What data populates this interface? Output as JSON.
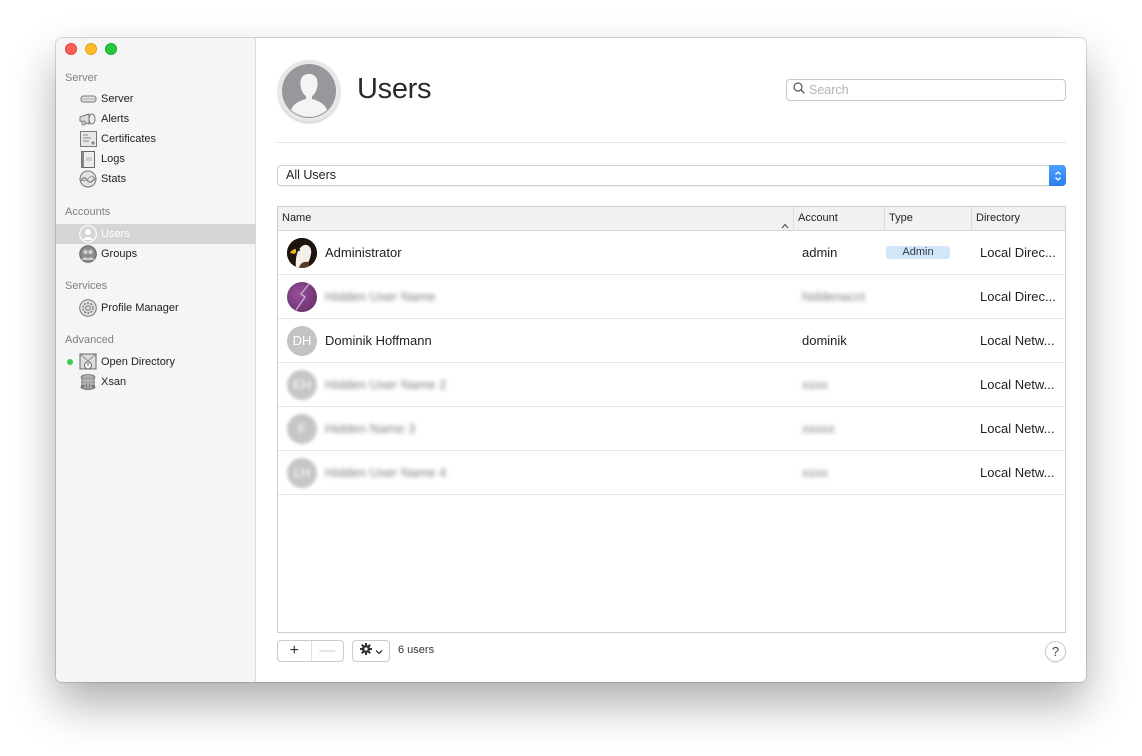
{
  "window": {
    "traffic_lights": [
      "close",
      "minimize",
      "zoom"
    ]
  },
  "sidebar": {
    "sections": [
      {
        "title": "Server",
        "items": [
          {
            "label": "Server",
            "icon": "server-icon"
          },
          {
            "label": "Alerts",
            "icon": "megaphone-icon"
          },
          {
            "label": "Certificates",
            "icon": "certificate-icon"
          },
          {
            "label": "Logs",
            "icon": "log-book-icon"
          },
          {
            "label": "Stats",
            "icon": "stats-icon"
          }
        ]
      },
      {
        "title": "Accounts",
        "items": [
          {
            "label": "Users",
            "icon": "user-icon",
            "selected": true
          },
          {
            "label": "Groups",
            "icon": "group-icon"
          }
        ]
      },
      {
        "title": "Services",
        "items": [
          {
            "label": "Profile Manager",
            "icon": "profile-manager-icon"
          }
        ]
      },
      {
        "title": "Advanced",
        "items": [
          {
            "label": "Open Directory",
            "icon": "open-directory-icon",
            "status": "running"
          },
          {
            "label": "Xsan",
            "icon": "xsan-icon"
          }
        ]
      }
    ]
  },
  "header": {
    "title": "Users",
    "icon": "user-silhouette-icon"
  },
  "search": {
    "placeholder": "Search",
    "value": ""
  },
  "filter": {
    "selected": "All Users"
  },
  "table": {
    "columns": [
      {
        "label": "Name",
        "sorted": "ascending"
      },
      {
        "label": "Account"
      },
      {
        "label": "Type"
      },
      {
        "label": "Directory"
      }
    ],
    "rows": [
      {
        "name": "Administrator",
        "account": "admin",
        "type": "Admin",
        "directory": "Local Direc...",
        "avatar": "eagle-photo",
        "initials": "",
        "redacted": false
      },
      {
        "name": "Hidden User Name",
        "account": "hiddenacct",
        "type": "",
        "directory": "Local Direc...",
        "avatar": "purple-photo",
        "initials": "",
        "redacted": true
      },
      {
        "name": "Dominik Hoffmann",
        "account": "dominik",
        "type": "",
        "directory": "Local Netw...",
        "avatar": "initials",
        "initials": "DH",
        "redacted": false
      },
      {
        "name": "Hidden User Name 2",
        "account": "xxxx",
        "type": "",
        "directory": "Local Netw...",
        "avatar": "initials",
        "initials": "EH",
        "redacted": true
      },
      {
        "name": "Hidden Name 3",
        "account": "xxxxx",
        "type": "",
        "directory": "Local Netw...",
        "avatar": "initials",
        "initials": "F",
        "redacted": true
      },
      {
        "name": "Hidden User Name 4",
        "account": "xxxx",
        "type": "",
        "directory": "Local Netw...",
        "avatar": "initials",
        "initials": "LH",
        "redacted": true
      }
    ]
  },
  "footer": {
    "add_label": "+",
    "remove_label": "—",
    "count_label": "6 users",
    "help_label": "?"
  },
  "colors": {
    "accent": "#2a7ef3",
    "admin_badge": "#d3e5f8",
    "status_running": "#3fce4a",
    "selection": "#d5d5d5"
  }
}
